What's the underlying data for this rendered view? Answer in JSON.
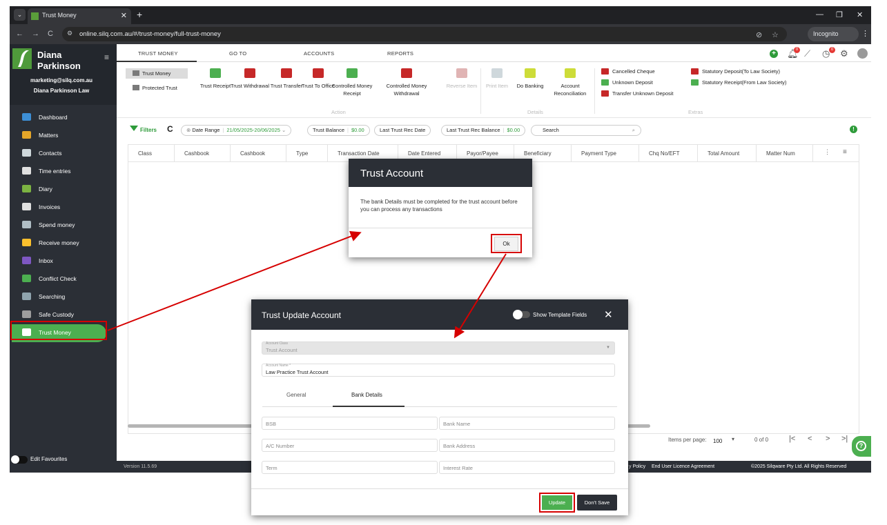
{
  "browser": {
    "tab_title": "Trust Money",
    "url": "online.silq.com.au/#/trust-money/full-trust-money",
    "incognito_label": "Incognito"
  },
  "sidebar": {
    "user_first": "Diana",
    "user_last": "Parkinson",
    "email": "marketing@silq.com.au",
    "firm": "Diana Parkinson Law",
    "items": [
      {
        "label": "Dashboard",
        "icon": "dashboard-icon",
        "color": "#3d8fd6"
      },
      {
        "label": "Matters",
        "icon": "matters-icon",
        "color": "#e5a629"
      },
      {
        "label": "Contacts",
        "icon": "contacts-icon",
        "color": "#cfd8dc"
      },
      {
        "label": "Time entries",
        "icon": "stopwatch-icon",
        "color": "#e0e0e0"
      },
      {
        "label": "Diary",
        "icon": "diary-icon",
        "color": "#7cb342"
      },
      {
        "label": "Invoices",
        "icon": "invoices-icon",
        "color": "#e0e0e0"
      },
      {
        "label": "Spend money",
        "icon": "spend-money-icon",
        "color": "#b0bec5"
      },
      {
        "label": "Receive money",
        "icon": "receive-money-icon",
        "color": "#fbc02d"
      },
      {
        "label": "Inbox",
        "icon": "inbox-icon",
        "color": "#7e57c2"
      },
      {
        "label": "Conflict Check",
        "icon": "check-icon",
        "color": "#4caf50"
      },
      {
        "label": "Searching",
        "icon": "search-icon",
        "color": "#90a4ae"
      },
      {
        "label": "Safe Custody",
        "icon": "safe-icon",
        "color": "#9e9e9e"
      },
      {
        "label": "Trust Money",
        "icon": "bank-icon",
        "color": "#ffffff"
      }
    ],
    "edit_favourites": "Edit Favourites"
  },
  "topnav": {
    "items": [
      "TRUST MONEY",
      "GO TO",
      "ACCOUNTS",
      "REPORTS"
    ],
    "notif_badge_1": "0",
    "notif_badge_2": "0"
  },
  "ribbon": {
    "side_buttons": [
      "Trust Money",
      "Protected Trust"
    ],
    "action_buttons": [
      {
        "label": "Trust Receipt",
        "color": "#4caf50",
        "disabled": false
      },
      {
        "label": "Trust Withdrawal",
        "color": "#c62828",
        "disabled": false
      },
      {
        "label": "Trust Transfer",
        "color": "#c62828",
        "disabled": false
      },
      {
        "label": "Trust To Office",
        "color": "#c62828",
        "disabled": false
      },
      {
        "label": "Controlled Money Receipt",
        "color": "#4caf50",
        "disabled": false
      },
      {
        "label": "Controlled Money Withdrawal",
        "color": "#c62828",
        "disabled": false
      },
      {
        "label": "Reverse Item",
        "color": "#e0b4b4",
        "disabled": true
      }
    ],
    "detail_buttons": [
      {
        "label": "Print Item",
        "color": "#cfd8dc",
        "disabled": true
      },
      {
        "label": "Do Banking",
        "color": "#cddc39",
        "disabled": false
      },
      {
        "label": "Account Reconciliation",
        "color": "#cddc39",
        "disabled": false
      }
    ],
    "extras_left": [
      "Cancelled Cheque",
      "Unknown Deposit",
      "Transfer Unknown Deposit"
    ],
    "extras_right": [
      "Statutory Deposit(To Law Society)",
      "Statutory Receipt(From Law Society)"
    ],
    "group_action": "Action",
    "group_details": "Details",
    "group_extras": "Extras"
  },
  "filters": {
    "label": "Filters",
    "date_range_label": "Date Range",
    "date_range_value": "21/05/2025-20/06/2025",
    "trust_balance_label": "Trust Balance",
    "trust_balance_value": "$0.00",
    "last_rec_date_label": "Last Trust Rec Date",
    "last_rec_balance_label": "Last Trust Rec Balance",
    "last_rec_balance_value": "$0.00",
    "search_label": "Search"
  },
  "grid": {
    "columns": [
      "Class",
      "Cashbook",
      "Cashbook",
      "Type",
      "Transaction Date",
      "Date Entered",
      "Payor/Payee",
      "Beneficiary",
      "Payment Type",
      "Chq No/EFT",
      "Total Amount",
      "Matter Num"
    ]
  },
  "pager": {
    "items_per_page_label": "Items per page:",
    "items_per_page": "100",
    "range": "0 of 0"
  },
  "footer": {
    "version": "Version 11.5.69",
    "policy": "y Policy",
    "eula": "End User Licence Agreement",
    "copyright": "©2025 Silqware Pty Ltd. All Rights Reserved"
  },
  "dialog1": {
    "title": "Trust Account",
    "message": "The bank Details must be completed for the trust account before you can process any transactions",
    "ok": "Ok"
  },
  "dialog2": {
    "title": "Trust Update Account",
    "show_template": "Show Template Fields",
    "account_class_label": "Account Class",
    "account_class_value": "Trust Account",
    "account_name_label": "Account Name *",
    "account_name_value": "Law Practice Trust Account",
    "tabs": [
      "General",
      "Bank Details"
    ],
    "fields": {
      "bsb": "BSB",
      "bank_name": "Bank Name",
      "ac_number": "A/C Number",
      "bank_address": "Bank Address",
      "term": "Term",
      "interest_rate": "Interest Rate"
    },
    "update": "Update",
    "dont_save": "Don't Save"
  },
  "colors": {
    "accent_green": "#4caf50",
    "dark_panel": "#2b2f36",
    "highlight_red": "#d60000"
  }
}
